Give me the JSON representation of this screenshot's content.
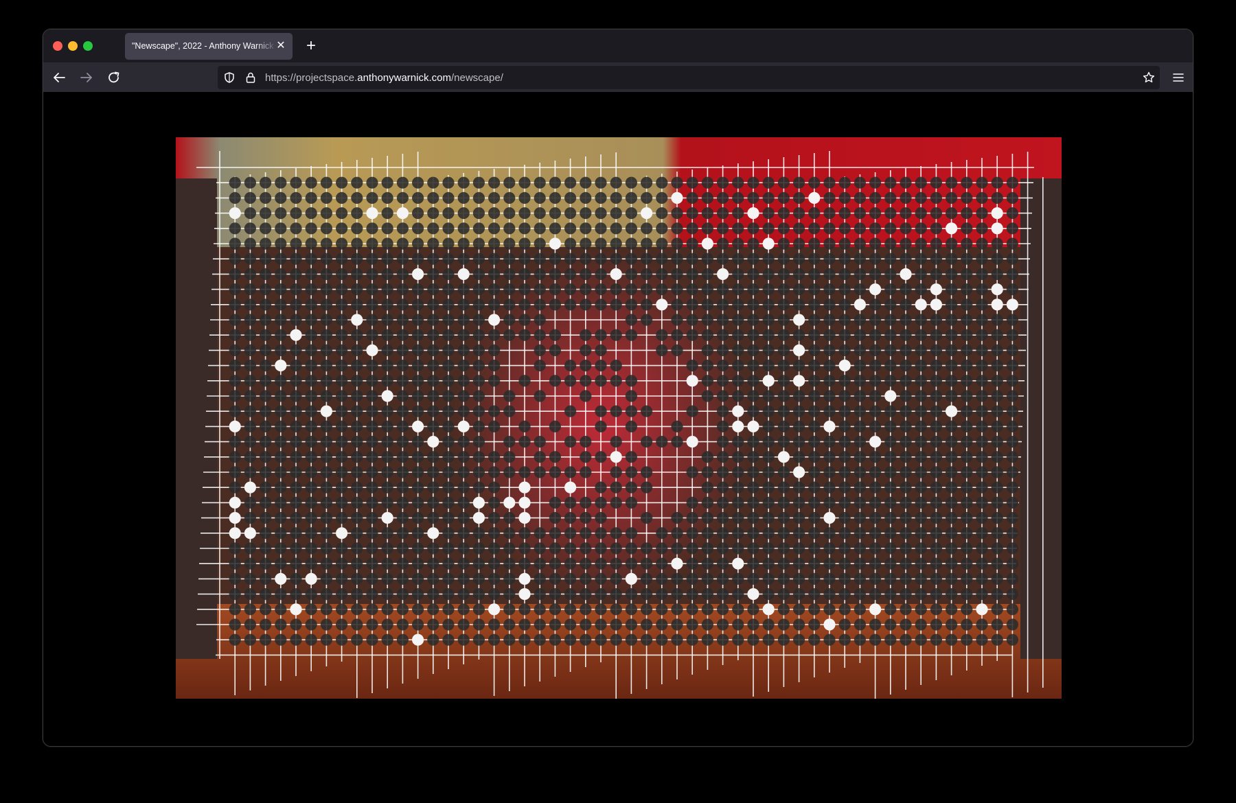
{
  "window": {
    "traffic_lights": [
      "close",
      "minimize",
      "maximize"
    ]
  },
  "tab": {
    "title": "\"Newscape\", 2022 - Anthony Warnick",
    "close_icon": "close-icon"
  },
  "toolbar": {
    "new_tab_icon": "plus-icon",
    "back_icon": "arrow-left-icon",
    "forward_icon": "arrow-right-icon",
    "reload_icon": "reload-icon",
    "url_prefix": "https://projectspace.",
    "url_domain": "anthonywarnick.com",
    "url_path": "/newscape/",
    "star_icon": "star-icon",
    "menu_icon": "hamburger-menu-icon"
  },
  "artwork": {
    "description_icon": "go-board-photo",
    "colors": {
      "curtain_red": "#b3121b",
      "curtain_gold": "#b89a55",
      "desk_wood": "#8a3a1e",
      "stone_black": "#2b2b2b",
      "stone_white": "#f4f4f4",
      "grid_line": "#ffffff"
    }
  },
  "colors": {
    "tabbar": "#1c1b22",
    "toolbar": "#2b2a33",
    "urlbar": "#1c1b22",
    "tab_active": "#42414d",
    "text": "#fbfbfe"
  }
}
